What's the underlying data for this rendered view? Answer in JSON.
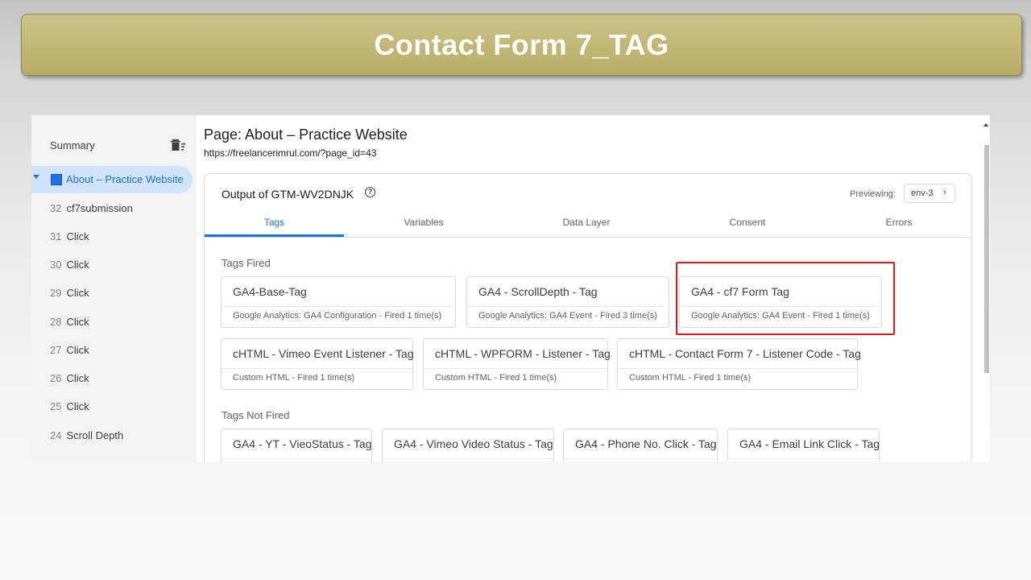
{
  "slide": {
    "title": "Contact Form 7_TAG"
  },
  "sidebar": {
    "summary_label": "Summary",
    "active_item": "About – Practice Website",
    "items": [
      {
        "num": "32",
        "label": "cf7submission"
      },
      {
        "num": "31",
        "label": "Click"
      },
      {
        "num": "30",
        "label": "Click"
      },
      {
        "num": "29",
        "label": "Click"
      },
      {
        "num": "28",
        "label": "Click"
      },
      {
        "num": "27",
        "label": "Click"
      },
      {
        "num": "26",
        "label": "Click"
      },
      {
        "num": "25",
        "label": "Click"
      },
      {
        "num": "24",
        "label": "Scroll Depth"
      }
    ]
  },
  "page": {
    "title": "Page: About – Practice Website",
    "url": "https://freelancerimrul.com/?page_id=43"
  },
  "output": {
    "title": "Output of GTM-WV2DNJK",
    "previewing_label": "Previewing:",
    "env": "env-3",
    "tabs": [
      "Tags",
      "Variables",
      "Data Layer",
      "Consent",
      "Errors"
    ],
    "active_tab": "Tags"
  },
  "tags_fired": {
    "label": "Tags Fired",
    "items": [
      {
        "name": "GA4-Base-Tag",
        "sub": "Google Analytics: GA4 Configuration - Fired 1 time(s)"
      },
      {
        "name": "GA4 - ScrollDepth - Tag",
        "sub": "Google Analytics: GA4 Event - Fired 3 time(s)"
      },
      {
        "name": "GA4 - cf7 Form Tag",
        "sub": "Google Analytics: GA4 Event - Fired 1 time(s)"
      },
      {
        "name": "cHTML - Vimeo Event Listener - Tag",
        "sub": "Custom HTML - Fired 1 time(s)"
      },
      {
        "name": "cHTML - WPFORM - Listener - Tag",
        "sub": "Custom HTML - Fired 1 time(s)"
      },
      {
        "name": "cHTML - Contact Form 7 - Listener Code - Tag",
        "sub": "Custom HTML - Fired 1 time(s)"
      }
    ]
  },
  "tags_not_fired": {
    "label": "Tags Not Fired",
    "items": [
      {
        "name": "GA4 - YT - VieoStatus - Tag"
      },
      {
        "name": "GA4 - Vimeo Video Status - Tag"
      },
      {
        "name": "GA4 - Phone No. Click - Tag"
      },
      {
        "name": "GA4 - Email Link Click - Tag"
      }
    ]
  },
  "colors": {
    "accent": "#1a73e8",
    "highlight": "#e01b1b",
    "banner": "#c2b978"
  }
}
